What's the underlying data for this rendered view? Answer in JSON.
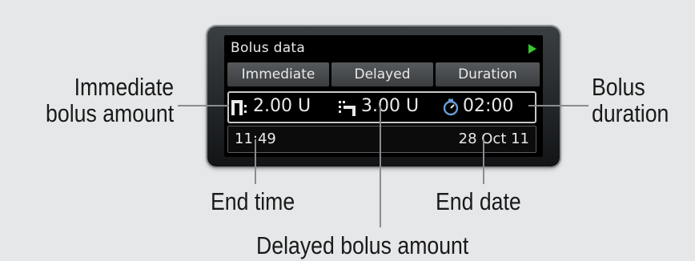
{
  "labels": {
    "immediate_l1": "Immediate",
    "immediate_l2": "bolus amount",
    "duration_l1": "Bolus",
    "duration_l2": "duration",
    "end_time": "End time",
    "end_date": "End date",
    "delayed": "Delayed bolus amount"
  },
  "screen": {
    "title": "Bolus data",
    "tabs": [
      "Immediate",
      "Delayed",
      "Duration"
    ],
    "immediate_value": "2.00 U",
    "delayed_value": "3.00 U",
    "duration_value": "02:00",
    "end_time": "11:49",
    "end_date": "28 Oct 11"
  },
  "colors": {
    "background": "#e6e7e8",
    "screen": "#000000",
    "text": "#e9e9e9",
    "play_arrow": "#36c82c",
    "leader_lines": "#8a8c8e"
  },
  "icons": [
    "play-arrow-icon",
    "immediate-bolus-icon",
    "delayed-bolus-icon",
    "timer-icon"
  ]
}
